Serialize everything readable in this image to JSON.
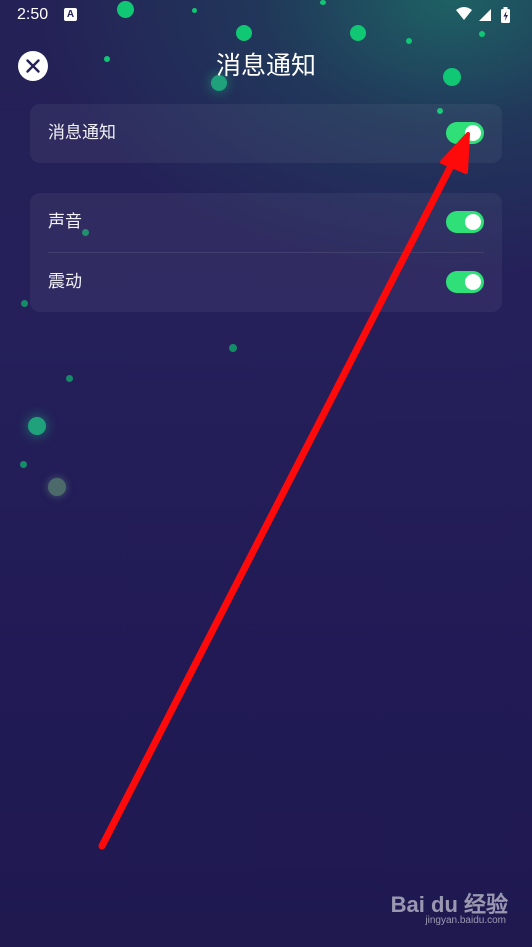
{
  "status_bar": {
    "time": "2:50",
    "notification_icon": "a-app-icon",
    "icons": [
      "wifi-icon",
      "signal-icon",
      "battery-charging-icon"
    ]
  },
  "header": {
    "title": "消息通知",
    "close_icon": "close-icon"
  },
  "settings": {
    "main_toggle": {
      "label": "消息通知",
      "enabled": true
    },
    "sub_toggles": [
      {
        "label": "声音",
        "enabled": true
      },
      {
        "label": "震动",
        "enabled": true
      }
    ]
  },
  "annotation": {
    "type": "red-arrow",
    "color": "#ff0000",
    "points_to": "main-notification-toggle"
  },
  "watermark": {
    "main": "Bai du 经验",
    "sub": "jingyan.baidu.com"
  },
  "colors": {
    "background": "#231e57",
    "toggle_on": "#2ee077",
    "accent_dots": "#10c774"
  }
}
